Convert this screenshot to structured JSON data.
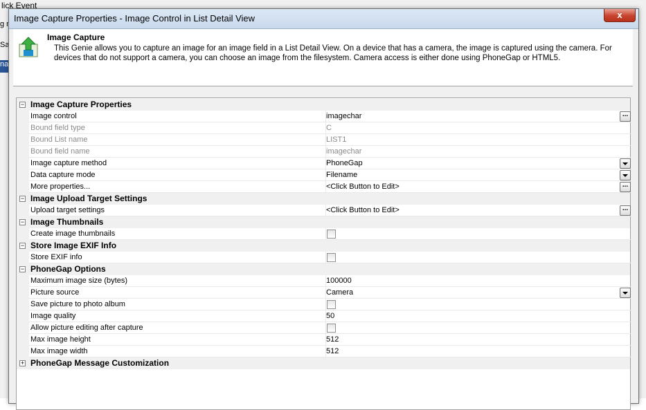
{
  "background": {
    "title_fragment": "lick Event",
    "frag1": "g m",
    "frag2": "Sa",
    "frag3": "na"
  },
  "dialog": {
    "title": "Image Capture Properties - Image Control in List Detail View",
    "close_label": "x",
    "close_color": "#c7432d"
  },
  "header": {
    "title": "Image Capture",
    "description": "This Genie allows you to capture an image for an image field in a List Detail View. On a device that has a camera, the image is captured using the camera. For devices that do not support a camera, you can choose an image from the filesystem. Camera access is either done using PhoneGap or HTML5.",
    "icon": "genie-upload-icon"
  },
  "categories": [
    {
      "label": "Image Capture Properties",
      "expanded": true,
      "props": [
        {
          "name": "Image control",
          "value": "imagechar",
          "editor": "ellipsis",
          "disabled": false
        },
        {
          "name": "Bound field type",
          "value": "C",
          "editor": "none",
          "disabled": true
        },
        {
          "name": "Bound List name",
          "value": "LIST1",
          "editor": "none",
          "disabled": true
        },
        {
          "name": "Bound field name",
          "value": "imagechar",
          "editor": "none",
          "disabled": true
        },
        {
          "name": "Image capture method",
          "value": "PhoneGap",
          "editor": "dropdown",
          "disabled": false
        },
        {
          "name": "Data capture mode",
          "value": "Filename",
          "editor": "dropdown",
          "disabled": false
        },
        {
          "name": "More properties...",
          "value": "<Click Button to Edit>",
          "editor": "ellipsis",
          "disabled": false
        }
      ]
    },
    {
      "label": "Image Upload Target Settings",
      "expanded": true,
      "props": [
        {
          "name": "Upload target settings",
          "value": "<Click Button to Edit>",
          "editor": "ellipsis",
          "disabled": false
        }
      ]
    },
    {
      "label": "Image Thumbnails",
      "expanded": true,
      "props": [
        {
          "name": "Create image thumbnails",
          "value": "",
          "editor": "checkbox",
          "disabled": false
        }
      ]
    },
    {
      "label": "Store Image EXIF Info",
      "expanded": true,
      "props": [
        {
          "name": "Store EXIF info",
          "value": "",
          "editor": "checkbox",
          "disabled": false
        }
      ]
    },
    {
      "label": "PhoneGap Options",
      "expanded": true,
      "props": [
        {
          "name": "Maximum image size (bytes)",
          "value": "100000",
          "editor": "none",
          "disabled": false
        },
        {
          "name": "Picture source",
          "value": "Camera",
          "editor": "dropdown",
          "disabled": false
        },
        {
          "name": "Save picture to photo album",
          "value": "",
          "editor": "checkbox",
          "disabled": false
        },
        {
          "name": "Image quality",
          "value": "50",
          "editor": "none",
          "disabled": false
        },
        {
          "name": "Allow picture editing after capture",
          "value": "",
          "editor": "checkbox",
          "disabled": false
        },
        {
          "name": "Max image height",
          "value": "512",
          "editor": "none",
          "disabled": false
        },
        {
          "name": "Max image width",
          "value": "512",
          "editor": "none",
          "disabled": false
        }
      ]
    },
    {
      "label": "PhoneGap Message Customization",
      "expanded": false,
      "props": []
    }
  ],
  "toggle_symbols": {
    "expanded": "−",
    "collapsed": "+"
  }
}
